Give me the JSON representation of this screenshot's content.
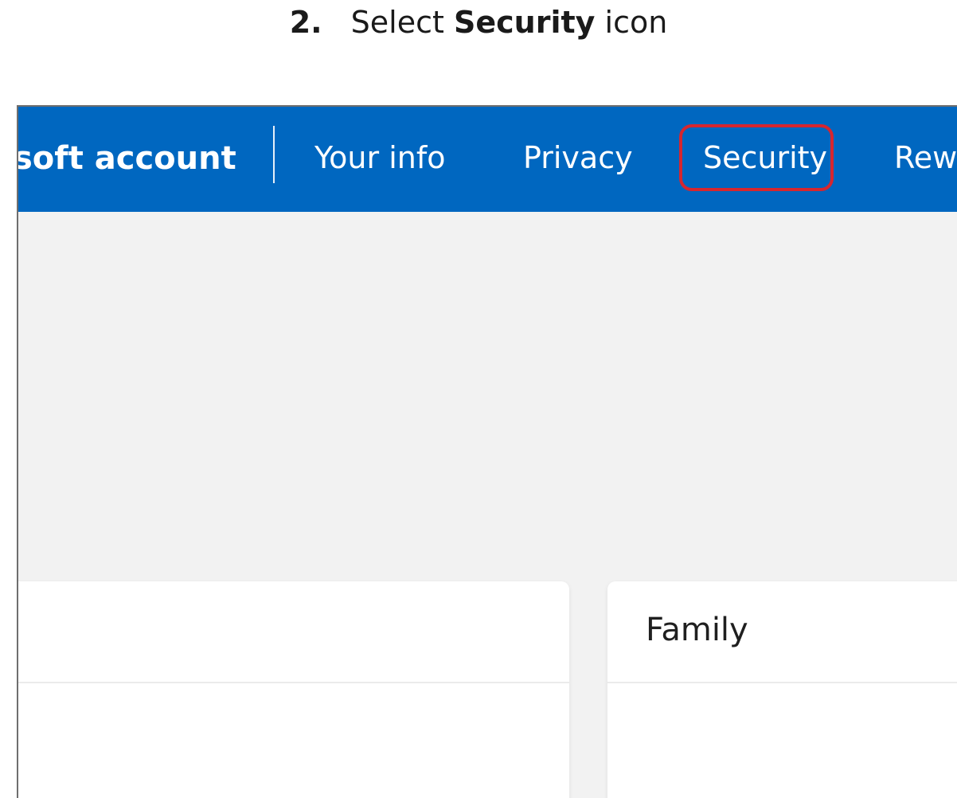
{
  "instruction": {
    "step_number": "2.",
    "prefix": "Select",
    "target": "Security",
    "suffix": "icon"
  },
  "nav": {
    "brand": "soft account",
    "items": [
      {
        "label": "Your info"
      },
      {
        "label": "Privacy"
      },
      {
        "label": "Security",
        "highlighted": true
      },
      {
        "label": "Rew"
      }
    ]
  },
  "cards": {
    "family_title": "Family"
  },
  "colors": {
    "nav_background": "#0067c0",
    "highlight": "#d6262f",
    "page_background": "#f2f2f2"
  }
}
